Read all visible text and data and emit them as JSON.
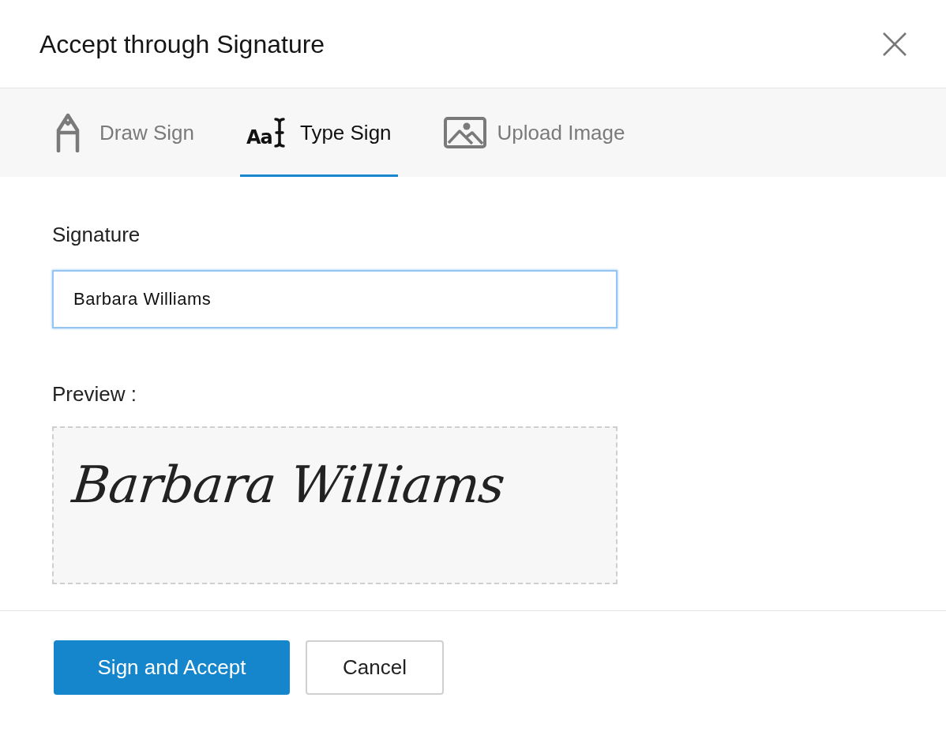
{
  "dialog": {
    "title": "Accept through Signature"
  },
  "tabs": [
    {
      "kind": "draw",
      "label": "Draw Sign",
      "selected": false
    },
    {
      "kind": "type",
      "label": "Type Sign",
      "icon_text": "Aa",
      "selected": true
    },
    {
      "kind": "upload",
      "label": "Upload Image",
      "selected": false
    }
  ],
  "signature": {
    "label": "Signature",
    "value": "Barbara Williams",
    "focused": true
  },
  "preview": {
    "label": "Preview :",
    "text": "Barbara Williams"
  },
  "buttons": [
    {
      "kind": "primary",
      "label": "Sign and Accept"
    },
    {
      "kind": "secondary",
      "label": "Cancel"
    }
  ]
}
